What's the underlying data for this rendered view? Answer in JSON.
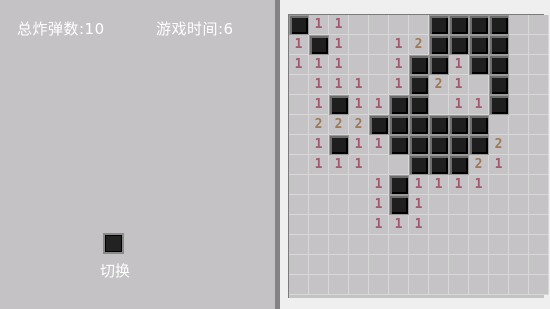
{
  "stats": {
    "total_bombs_label": "总炸弹数:10",
    "game_time_label": "游戏时间:6"
  },
  "controls": {
    "switch_label": "切换"
  },
  "colors": {
    "background": "#c5c2c5",
    "covered_cell": "#1e1e1e",
    "number_1": "#a45a6e",
    "number_2": "#9c7a58",
    "text": "#ffffff"
  },
  "board": {
    "rows": 14,
    "cols": 13,
    "legend": "# = covered, . = empty revealed, digits = adjacent mine count",
    "grid": [
      "#11....####",
      "1#1..12####",
      "111..1##1##",
      ".111.1#21.#",
      ".1#11##.11#",
      ".222######",
      ".1#11#####2",
      ".111..###21",
      "....1#1111.",
      "....1#1....",
      "....111....",
      "...........",
      "...........",
      "..........."
    ]
  }
}
